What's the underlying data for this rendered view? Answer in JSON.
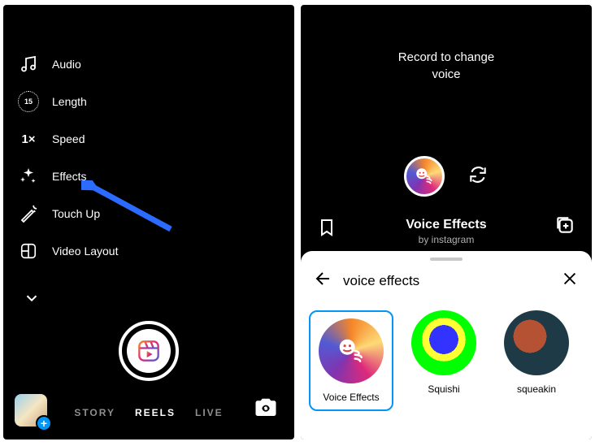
{
  "left": {
    "tools": {
      "audio": "Audio",
      "length": "Length",
      "length_value": "15",
      "speed": "Speed",
      "speed_value": "1×",
      "effects": "Effects",
      "touchup": "Touch Up",
      "layout": "Video Layout"
    },
    "modes": {
      "story": "STORY",
      "reels": "REELS",
      "live": "LIVE"
    }
  },
  "right": {
    "record_line1": "Record to change",
    "record_line2": "voice",
    "effect_name": "Voice Effects",
    "effect_author": "by instagram",
    "search_term": "voice effects",
    "results": {
      "r0": "Voice Effects",
      "r1": "Squishi",
      "r2": "squeakin"
    }
  }
}
